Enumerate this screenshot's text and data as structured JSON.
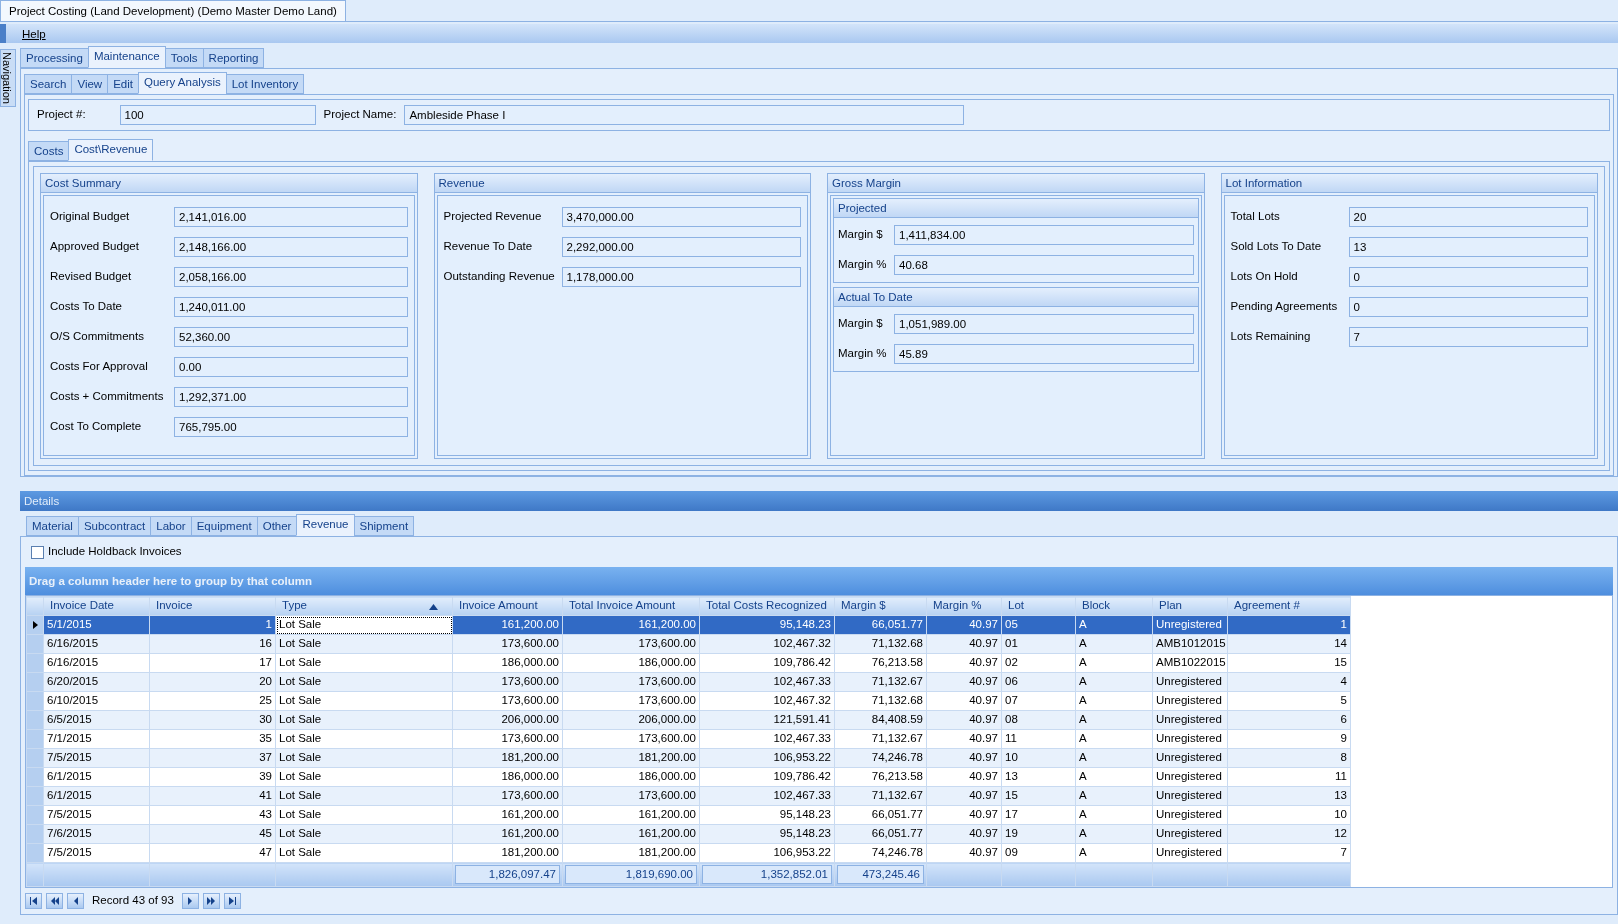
{
  "window": {
    "title": "Project Costing (Land Development) (Demo Master Demo Land)"
  },
  "menu": [
    "Help"
  ],
  "side_tab": "Navigation",
  "ribbon_tabs": [
    {
      "label": "Processing",
      "selected": false
    },
    {
      "label": "Maintenance",
      "selected": true
    },
    {
      "label": "Tools",
      "selected": false
    },
    {
      "label": "Reporting",
      "selected": false
    }
  ],
  "sub_tabs": [
    {
      "label": "Search",
      "selected": false
    },
    {
      "label": "View",
      "selected": false
    },
    {
      "label": "Edit",
      "selected": false
    },
    {
      "label": "Query Analysis",
      "selected": true
    },
    {
      "label": "Lot Inventory",
      "selected": false
    }
  ],
  "project": [
    {
      "label": "Project #:",
      "value": "100"
    },
    {
      "label": "Project Name:",
      "value": "Ambleside Phase I"
    }
  ],
  "view_tabs": [
    {
      "label": "Costs",
      "selected": false
    },
    {
      "label": "Cost\\Revenue",
      "selected": true
    }
  ],
  "panels": [
    {
      "kind": "fields",
      "title": "Cost Summary",
      "fields": [
        {
          "label": "Original Budget",
          "value": "2,141,016.00"
        },
        {
          "label": "Approved Budget",
          "value": "2,148,166.00"
        },
        {
          "label": "Revised Budget",
          "value": "2,058,166.00"
        },
        {
          "label": "Costs To Date",
          "value": "1,240,011.00"
        },
        {
          "label": "O/S Commitments",
          "value": "52,360.00"
        },
        {
          "label": "Costs For Approval",
          "value": "0.00"
        },
        {
          "label": "Costs + Commitments",
          "value": "1,292,371.00"
        },
        {
          "label": "Cost To Complete",
          "value": "765,795.00"
        }
      ]
    },
    {
      "kind": "fields",
      "title": "Revenue",
      "fields": [
        {
          "label": "Projected Revenue",
          "value": "3,470,000.00"
        },
        {
          "label": "Revenue To Date",
          "value": "2,292,000.00"
        },
        {
          "label": "Outstanding Revenue",
          "value": "1,178,000.00"
        }
      ]
    },
    {
      "kind": "groups",
      "title": "Gross Margin",
      "groups": [
        {
          "title": "Projected",
          "fields": [
            {
              "label": "Margin $",
              "value": "1,411,834.00"
            },
            {
              "label": "Margin %",
              "value": "40.68"
            }
          ]
        },
        {
          "title": "Actual To Date",
          "fields": [
            {
              "label": "Margin $",
              "value": "1,051,989.00"
            },
            {
              "label": "Margin %",
              "value": "45.89"
            }
          ]
        }
      ]
    },
    {
      "kind": "fields",
      "title": "Lot Information",
      "fields": [
        {
          "label": "Total Lots",
          "value": "20"
        },
        {
          "label": "Sold Lots To Date",
          "value": "13"
        },
        {
          "label": "Lots On Hold",
          "value": "0"
        },
        {
          "label": "Pending Agreements",
          "value": "0"
        },
        {
          "label": "Lots Remaining",
          "value": "7"
        }
      ]
    }
  ],
  "details": {
    "title": "Details",
    "tabs": [
      {
        "label": "Material",
        "selected": false
      },
      {
        "label": "Subcontract",
        "selected": false
      },
      {
        "label": "Labor",
        "selected": false
      },
      {
        "label": "Equipment",
        "selected": false
      },
      {
        "label": "Other",
        "selected": false
      },
      {
        "label": "Revenue",
        "selected": true
      },
      {
        "label": "Shipment",
        "selected": false
      }
    ],
    "checkbox": {
      "label": "Include Holdback Invoices",
      "checked": false
    },
    "group_panel": "Drag a column header here to group by that column",
    "table": {
      "columns": [
        {
          "label": "Invoice Date",
          "sorted": false
        },
        {
          "label": "Invoice",
          "sorted": false
        },
        {
          "label": "Type",
          "sorted": true
        },
        {
          "label": "Invoice Amount",
          "sorted": false,
          "total": "1,826,097.47"
        },
        {
          "label": "Total Invoice Amount",
          "sorted": false,
          "total": "1,819,690.00"
        },
        {
          "label": "Total Costs Recognized",
          "sorted": false,
          "total": "1,352,852.01"
        },
        {
          "label": "Margin $",
          "sorted": false,
          "total": "473,245.46"
        },
        {
          "label": "Margin %",
          "sorted": false
        },
        {
          "label": "Lot",
          "sorted": false
        },
        {
          "label": "Block",
          "sorted": false
        },
        {
          "label": "Plan",
          "sorted": false
        },
        {
          "label": "Agreement #",
          "sorted": false
        }
      ],
      "rows": [
        {
          "selected": true,
          "cells": [
            "5/1/2015",
            "1",
            "Lot Sale",
            "161,200.00",
            "161,200.00",
            "95,148.23",
            "66,051.77",
            "40.97",
            "05",
            "A",
            "Unregistered",
            "1"
          ]
        },
        {
          "selected": false,
          "cells": [
            "6/16/2015",
            "16",
            "Lot Sale",
            "173,600.00",
            "173,600.00",
            "102,467.32",
            "71,132.68",
            "40.97",
            "01",
            "A",
            "AMB1012015",
            "14"
          ]
        },
        {
          "selected": false,
          "cells": [
            "6/16/2015",
            "17",
            "Lot Sale",
            "186,000.00",
            "186,000.00",
            "109,786.42",
            "76,213.58",
            "40.97",
            "02",
            "A",
            "AMB1022015",
            "15"
          ]
        },
        {
          "selected": false,
          "cells": [
            "6/20/2015",
            "20",
            "Lot Sale",
            "173,600.00",
            "173,600.00",
            "102,467.33",
            "71,132.67",
            "40.97",
            "06",
            "A",
            "Unregistered",
            "4"
          ]
        },
        {
          "selected": false,
          "cells": [
            "6/10/2015",
            "25",
            "Lot Sale",
            "173,600.00",
            "173,600.00",
            "102,467.32",
            "71,132.68",
            "40.97",
            "07",
            "A",
            "Unregistered",
            "5"
          ]
        },
        {
          "selected": false,
          "cells": [
            "6/5/2015",
            "30",
            "Lot Sale",
            "206,000.00",
            "206,000.00",
            "121,591.41",
            "84,408.59",
            "40.97",
            "08",
            "A",
            "Unregistered",
            "6"
          ]
        },
        {
          "selected": false,
          "cells": [
            "7/1/2015",
            "35",
            "Lot Sale",
            "173,600.00",
            "173,600.00",
            "102,467.33",
            "71,132.67",
            "40.97",
            "11",
            "A",
            "Unregistered",
            "9"
          ]
        },
        {
          "selected": false,
          "cells": [
            "7/5/2015",
            "37",
            "Lot Sale",
            "181,200.00",
            "181,200.00",
            "106,953.22",
            "74,246.78",
            "40.97",
            "10",
            "A",
            "Unregistered",
            "8"
          ]
        },
        {
          "selected": false,
          "cells": [
            "6/1/2015",
            "39",
            "Lot Sale",
            "186,000.00",
            "186,000.00",
            "109,786.42",
            "76,213.58",
            "40.97",
            "13",
            "A",
            "Unregistered",
            "11"
          ]
        },
        {
          "selected": false,
          "cells": [
            "6/1/2015",
            "41",
            "Lot Sale",
            "173,600.00",
            "173,600.00",
            "102,467.33",
            "71,132.67",
            "40.97",
            "15",
            "A",
            "Unregistered",
            "13"
          ]
        },
        {
          "selected": false,
          "cells": [
            "7/5/2015",
            "43",
            "Lot Sale",
            "161,200.00",
            "161,200.00",
            "95,148.23",
            "66,051.77",
            "40.97",
            "17",
            "A",
            "Unregistered",
            "10"
          ]
        },
        {
          "selected": false,
          "cells": [
            "7/6/2015",
            "45",
            "Lot Sale",
            "161,200.00",
            "161,200.00",
            "95,148.23",
            "66,051.77",
            "40.97",
            "19",
            "A",
            "Unregistered",
            "12"
          ]
        },
        {
          "selected": false,
          "cells": [
            "7/5/2015",
            "47",
            "Lot Sale",
            "181,200.00",
            "181,200.00",
            "106,953.22",
            "74,246.78",
            "40.97",
            "09",
            "A",
            "Unregistered",
            "7"
          ]
        }
      ]
    },
    "pager": {
      "record": "Record 43 of 93"
    }
  }
}
